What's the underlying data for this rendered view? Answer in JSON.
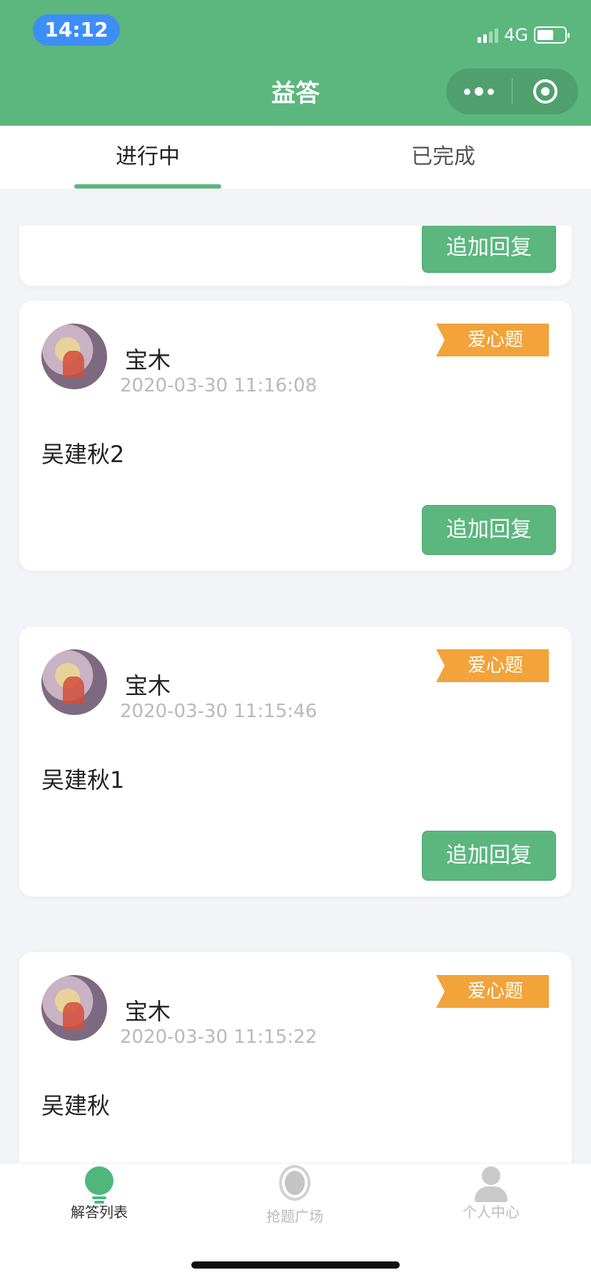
{
  "status_bar": {
    "time": "14:12",
    "network": "4G"
  },
  "header": {
    "title": "益答"
  },
  "tabs": [
    {
      "label": "进行中",
      "active": true
    },
    {
      "label": "已完成",
      "active": false
    }
  ],
  "cards": [
    {
      "reply_label": "追加回复"
    },
    {
      "name": "宝木",
      "date": "2020-03-30 11:16:08",
      "tag": "爱心题",
      "content": "吴建秋2",
      "reply_label": "追加回复"
    },
    {
      "name": "宝木",
      "date": "2020-03-30 11:15:46",
      "tag": "爱心题",
      "content": "吴建秋1",
      "reply_label": "追加回复"
    },
    {
      "name": "宝木",
      "date": "2020-03-30 11:15:22",
      "tag": "爱心题",
      "content": "吴建秋"
    }
  ],
  "bottom_nav": [
    {
      "label": "解答列表",
      "icon": "bulb-icon",
      "active": true
    },
    {
      "label": "抢题广场",
      "icon": "radar-icon",
      "active": false
    },
    {
      "label": "个人中心",
      "icon": "person-icon",
      "active": false
    }
  ],
  "colors": {
    "primary": "#5bb77d",
    "tag": "#f2a33a",
    "time_pill": "#3e8ef7"
  }
}
